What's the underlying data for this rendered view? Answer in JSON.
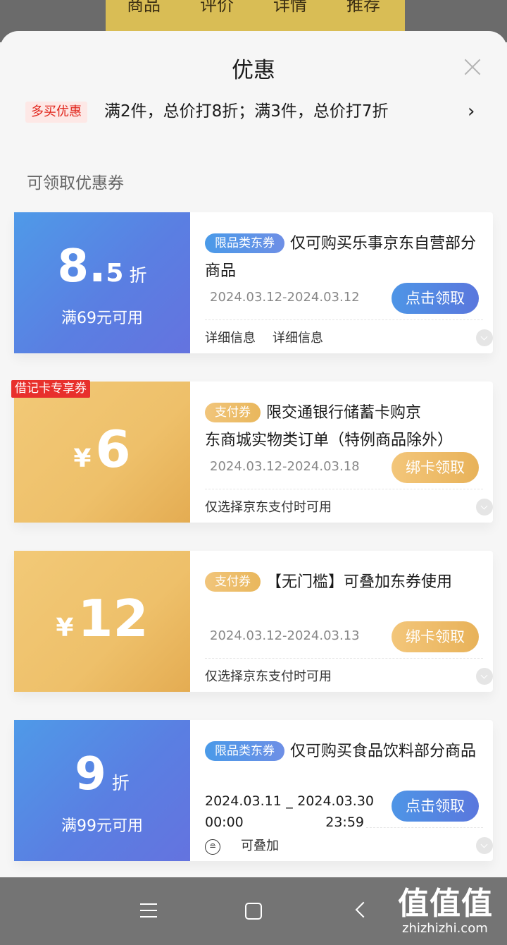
{
  "background_app": {
    "tabs": [
      "商品",
      "评价",
      "详情",
      "推荐"
    ]
  },
  "sheet": {
    "title": "优惠",
    "close_icon": "close-icon"
  },
  "promo": {
    "tag": "多买优惠",
    "text": "满2件，总价打8折；满3件，总价打7折",
    "arrow": "›"
  },
  "section_title": "可领取优惠券",
  "coupons": [
    {
      "value_main": "8",
      "value_dot": ".",
      "value_decimal": "5",
      "value_unit": "折",
      "condition": "满69元可用",
      "badge": "限品类东券",
      "desc": "仅可购买乐事京东自营部分商品",
      "date": "2024.03.12-2024.03.12",
      "button": "点击领取",
      "info_1": "详细信息",
      "info_2": "详细信息",
      "theme_color": "#5a86e4"
    },
    {
      "corner_badge": "借记卡专享券",
      "currency": "¥",
      "amount": "6",
      "badge": "支付券",
      "desc_line1": "限交通银行储蓄卡购京",
      "desc_line2": "东商城实物类订单（特例商品除外）",
      "date": "2024.03.12-2024.03.18",
      "button": "绑卡领取",
      "info": "仅选择京东支付时可用",
      "theme_color": "#eec06a"
    },
    {
      "currency": "¥",
      "amount": "12",
      "badge": "支付券",
      "desc": "【无门槛】可叠加东券使用",
      "date": "2024.03.12-2024.03.13",
      "button": "绑卡领取",
      "info": "仅选择京东支付时可用",
      "theme_color": "#eec06a"
    },
    {
      "value_main": "9",
      "value_unit": "折",
      "condition": "满99元可用",
      "badge": "限品类东券",
      "desc": "仅可购买食品饮料部分商品",
      "date_start": "2024.03.11",
      "date_sep": "_",
      "date_end": "2024.03.30",
      "time_start": "00:00",
      "time_end": "23:59",
      "button": "点击领取",
      "stack_icon": "stack-icon",
      "info": "可叠加",
      "theme_color": "#5a86e4"
    }
  ],
  "navbar": {
    "watermark_logo": "值值值",
    "watermark_domain": "zhizhizhi.com"
  }
}
